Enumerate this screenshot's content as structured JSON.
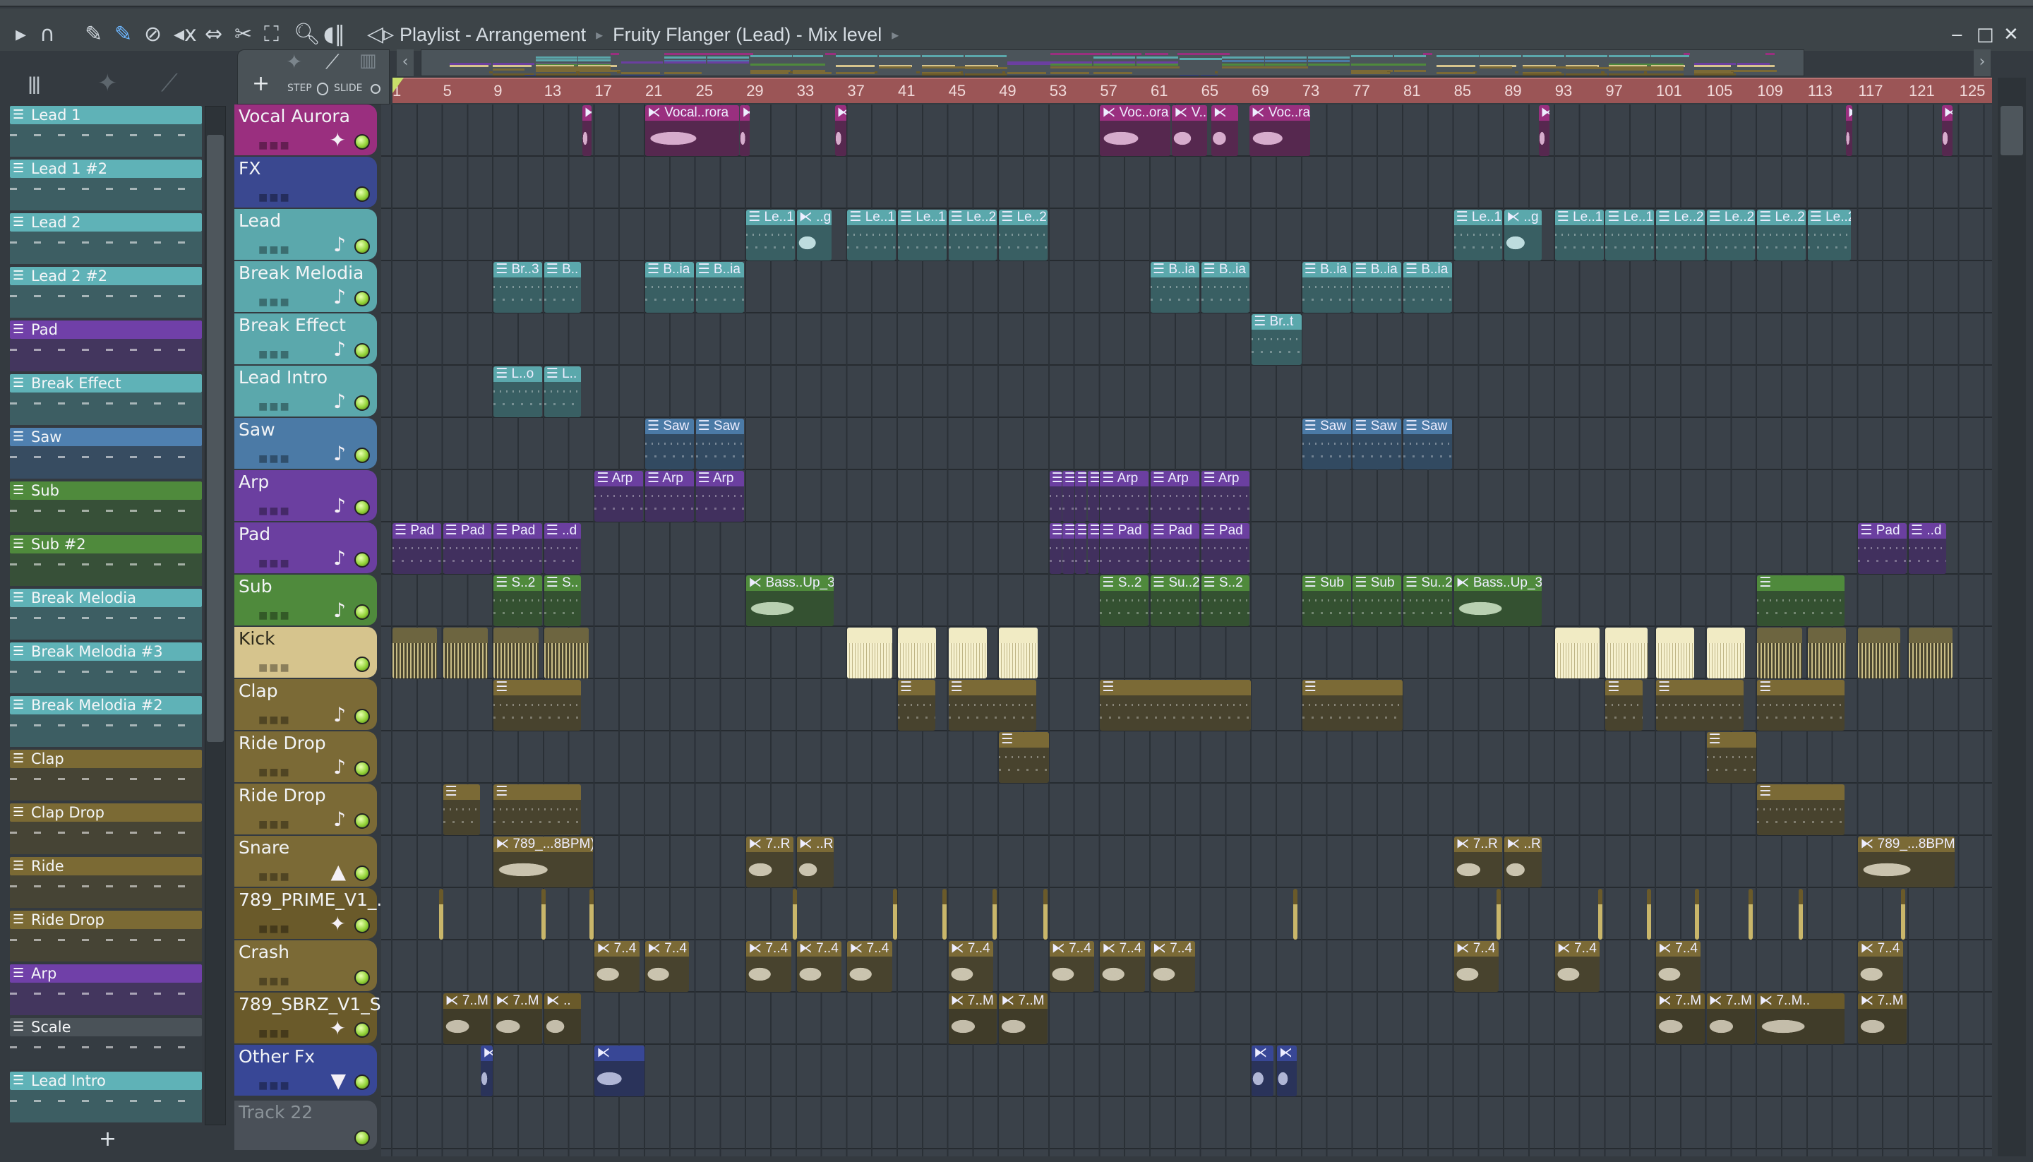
{
  "toolbar": {
    "breadcrumb_1": "Playlist - Arrangement",
    "breadcrumb_2": "Fruity Flanger (Lead) - Mix level",
    "step_label": "STEP",
    "slide_label": "SLIDE",
    "add_label": "+",
    "icons": [
      "arrow-icon",
      "magnet-icon",
      "pencil-icon",
      "paint-icon",
      "delete-icon",
      "mute-icon",
      "slip-icon",
      "slice-icon",
      "select-icon",
      "zoom-icon",
      "playback-icon",
      "speaker-icon"
    ]
  },
  "window": {
    "minimize": "‒",
    "maximize": "□",
    "close": "✕"
  },
  "ruler": {
    "labels": [
      "1",
      "5",
      "9",
      "13",
      "17",
      "21",
      "25",
      "29",
      "33",
      "37",
      "41",
      "45",
      "49",
      "53",
      "57",
      "61",
      "65",
      "69",
      "73",
      "77",
      "81",
      "85",
      "89",
      "93",
      "97",
      "101",
      "105",
      "109",
      "113",
      "117",
      "121",
      "125"
    ]
  },
  "channels": [
    {
      "name": "Lead 1",
      "color": "#5fb2b7"
    },
    {
      "name": "Lead 1 #2",
      "color": "#5fb2b7"
    },
    {
      "name": "Lead 2",
      "color": "#5fb2b7"
    },
    {
      "name": "Lead 2 #2",
      "color": "#5fb2b7"
    },
    {
      "name": "Pad",
      "color": "#7040a8"
    },
    {
      "name": "Break Effect",
      "color": "#5fb2b7"
    },
    {
      "name": "Saw",
      "color": "#4f80b0"
    },
    {
      "name": "Sub",
      "color": "#4f8a3c"
    },
    {
      "name": "Sub #2",
      "color": "#4f8a3c"
    },
    {
      "name": "Break Melodia",
      "color": "#5fb2b7"
    },
    {
      "name": "Break Melodia #3",
      "color": "#5fb2b7"
    },
    {
      "name": "Break Melodia #2",
      "color": "#5fb2b7"
    },
    {
      "name": "Clap",
      "color": "#7b6a34"
    },
    {
      "name": "Clap Drop",
      "color": "#7b6a34"
    },
    {
      "name": "Ride",
      "color": "#7b6a34"
    },
    {
      "name": "Ride Drop",
      "color": "#7b6a34"
    },
    {
      "name": "Arp",
      "color": "#7040a8"
    },
    {
      "name": "Scale",
      "color": "#4a5258"
    },
    {
      "name": "Lead Intro",
      "color": "#5fb2b7"
    }
  ],
  "channel_add": "+",
  "tracks": [
    {
      "name": "Vocal Aurora",
      "color": "#9a2f7f",
      "icon": "✦",
      "clips": [
        {
          "s": 16,
          "l": 0.8,
          "t": "",
          "k": "a"
        },
        {
          "s": 21,
          "l": 7.5,
          "t": "Vocal..rora",
          "k": "a"
        },
        {
          "s": 28.5,
          "l": 0.8,
          "t": "",
          "k": "a"
        },
        {
          "s": 36,
          "l": 1,
          "t": "",
          "k": "a"
        },
        {
          "s": 57,
          "l": 5.6,
          "t": "Voc..ora",
          "k": "a"
        },
        {
          "s": 62.7,
          "l": 2.8,
          "t": "V..",
          "k": "a"
        },
        {
          "s": 65.8,
          "l": 2.2,
          "t": "",
          "k": "a"
        },
        {
          "s": 68.8,
          "l": 4.9,
          "t": "Voc..ra",
          "k": "a"
        },
        {
          "s": 91.7,
          "l": 0.9,
          "t": "",
          "k": "a"
        },
        {
          "s": 116,
          "l": 0.6,
          "t": "",
          "k": "a"
        },
        {
          "s": 123.6,
          "l": 0.9,
          "t": "",
          "k": "a"
        }
      ]
    },
    {
      "name": "FX",
      "color": "#3a4890",
      "icon": "",
      "clips": []
    },
    {
      "name": "Lead",
      "color": "#5ba8ac",
      "icon": "♪",
      "clips": [
        {
          "s": 29,
          "l": 3.9,
          "t": "Le..1",
          "k": "p"
        },
        {
          "s": 33,
          "l": 2.8,
          "t": "..g",
          "k": "a"
        },
        {
          "s": 37,
          "l": 3.9,
          "t": "Le..1",
          "k": "p"
        },
        {
          "s": 41,
          "l": 3.9,
          "t": "Le..1",
          "k": "p"
        },
        {
          "s": 45,
          "l": 3.9,
          "t": "Le..2",
          "k": "p"
        },
        {
          "s": 49,
          "l": 3.9,
          "t": "Le..2",
          "k": "p"
        },
        {
          "s": 85,
          "l": 3.9,
          "t": "Le..1",
          "k": "p"
        },
        {
          "s": 89,
          "l": 3,
          "t": "..g",
          "k": "a"
        },
        {
          "s": 93,
          "l": 3.9,
          "t": "Le..1",
          "k": "p"
        },
        {
          "s": 97,
          "l": 3.9,
          "t": "Le..1",
          "k": "p"
        },
        {
          "s": 101,
          "l": 3.9,
          "t": "Le..2",
          "k": "p"
        },
        {
          "s": 105,
          "l": 3.9,
          "t": "Le..2",
          "k": "p"
        },
        {
          "s": 109,
          "l": 3.9,
          "t": "Le..2",
          "k": "p"
        },
        {
          "s": 113,
          "l": 3.5,
          "t": "Le..2",
          "k": "p"
        }
      ]
    },
    {
      "name": "Break Melodia",
      "color": "#5ba8ac",
      "icon": "♪",
      "clips": [
        {
          "s": 9,
          "l": 3.9,
          "t": "Br..3",
          "k": "p"
        },
        {
          "s": 13,
          "l": 3,
          "t": "B..",
          "k": "p"
        },
        {
          "s": 21,
          "l": 3.9,
          "t": "B..ia",
          "k": "p"
        },
        {
          "s": 25,
          "l": 3.9,
          "t": "B..ia",
          "k": "p"
        },
        {
          "s": 61,
          "l": 3.9,
          "t": "B..ia",
          "k": "p"
        },
        {
          "s": 65,
          "l": 3.9,
          "t": "B..ia",
          "k": "p"
        },
        {
          "s": 73,
          "l": 3.9,
          "t": "B..ia",
          "k": "p"
        },
        {
          "s": 77,
          "l": 3.9,
          "t": "B..ia",
          "k": "p"
        },
        {
          "s": 81,
          "l": 3.9,
          "t": "B..ia",
          "k": "p"
        }
      ]
    },
    {
      "name": "Break Effect",
      "color": "#5ba8ac",
      "icon": "♪",
      "clips": [
        {
          "s": 69,
          "l": 4,
          "t": "Br..t",
          "k": "p"
        }
      ]
    },
    {
      "name": "Lead Intro",
      "color": "#5ba8ac",
      "icon": "♪",
      "clips": [
        {
          "s": 9,
          "l": 3.9,
          "t": "L..o",
          "k": "p"
        },
        {
          "s": 13,
          "l": 3,
          "t": "L..",
          "k": "p"
        }
      ]
    },
    {
      "name": "Saw",
      "color": "#4b7aa6",
      "icon": "♪",
      "clips": [
        {
          "s": 21,
          "l": 3.9,
          "t": "Saw",
          "k": "p"
        },
        {
          "s": 25,
          "l": 3.9,
          "t": "Saw",
          "k": "p"
        },
        {
          "s": 73,
          "l": 3.9,
          "t": "Saw",
          "k": "p"
        },
        {
          "s": 77,
          "l": 3.9,
          "t": "Saw",
          "k": "p"
        },
        {
          "s": 81,
          "l": 3.9,
          "t": "Saw",
          "k": "p"
        }
      ]
    },
    {
      "name": "Arp",
      "color": "#6b3fa0",
      "icon": "♪",
      "clips": [
        {
          "s": 17,
          "l": 3.9,
          "t": "Arp",
          "k": "p"
        },
        {
          "s": 21,
          "l": 3.9,
          "t": "Arp",
          "k": "p"
        },
        {
          "s": 25,
          "l": 3.9,
          "t": "Arp",
          "k": "p"
        },
        {
          "s": 53,
          "l": 1,
          "t": "",
          "k": "p"
        },
        {
          "s": 54,
          "l": 1,
          "t": "",
          "k": "p"
        },
        {
          "s": 55,
          "l": 1,
          "t": "",
          "k": "p"
        },
        {
          "s": 56,
          "l": 1,
          "t": "",
          "k": "p"
        },
        {
          "s": 57,
          "l": 3.9,
          "t": "Arp",
          "k": "p"
        },
        {
          "s": 61,
          "l": 3.9,
          "t": "Arp",
          "k": "p"
        },
        {
          "s": 65,
          "l": 3.9,
          "t": "Arp",
          "k": "p"
        }
      ]
    },
    {
      "name": "Pad",
      "color": "#6b3fa0",
      "icon": "♪",
      "clips": [
        {
          "s": 1,
          "l": 3.9,
          "t": "Pad",
          "k": "p"
        },
        {
          "s": 5,
          "l": 3.9,
          "t": "Pad",
          "k": "p"
        },
        {
          "s": 9,
          "l": 3.9,
          "t": "Pad",
          "k": "p"
        },
        {
          "s": 13,
          "l": 3,
          "t": "..d",
          "k": "p"
        },
        {
          "s": 53,
          "l": 1,
          "t": "",
          "k": "p"
        },
        {
          "s": 54,
          "l": 1,
          "t": "",
          "k": "p"
        },
        {
          "s": 55,
          "l": 1,
          "t": "",
          "k": "p"
        },
        {
          "s": 56,
          "l": 1,
          "t": "",
          "k": "p"
        },
        {
          "s": 57,
          "l": 3.9,
          "t": "Pad",
          "k": "p"
        },
        {
          "s": 61,
          "l": 3.9,
          "t": "Pad",
          "k": "p"
        },
        {
          "s": 65,
          "l": 3.9,
          "t": "Pad",
          "k": "p"
        },
        {
          "s": 117,
          "l": 3.9,
          "t": "Pad",
          "k": "p"
        },
        {
          "s": 121,
          "l": 3,
          "t": "..d",
          "k": "p"
        }
      ]
    },
    {
      "name": "Sub",
      "color": "#4f8a3c",
      "icon": "♪",
      "clips": [
        {
          "s": 9,
          "l": 3.9,
          "t": "S..2",
          "k": "p"
        },
        {
          "s": 13,
          "l": 3,
          "t": "S..",
          "k": "p"
        },
        {
          "s": 29,
          "l": 7,
          "t": "Bass..Up_3",
          "k": "a"
        },
        {
          "s": 57,
          "l": 3.9,
          "t": "S..2",
          "k": "p"
        },
        {
          "s": 61,
          "l": 3.9,
          "t": "Su..2",
          "k": "p"
        },
        {
          "s": 65,
          "l": 3.9,
          "t": "S..2",
          "k": "p"
        },
        {
          "s": 73,
          "l": 3.9,
          "t": "Sub",
          "k": "p"
        },
        {
          "s": 77,
          "l": 3.9,
          "t": "Sub",
          "k": "p"
        },
        {
          "s": 81,
          "l": 3.9,
          "t": "Su..2",
          "k": "p"
        },
        {
          "s": 85,
          "l": 7,
          "t": "Bass..Up_3",
          "k": "a"
        },
        {
          "s": 109,
          "l": 7,
          "t": "",
          "k": "p"
        }
      ]
    },
    {
      "name": "Kick",
      "color": "#d6c48d",
      "icon": "",
      "clips": [
        {
          "s": 1,
          "l": 3.6,
          "t": "",
          "k": "k"
        },
        {
          "s": 5,
          "l": 3.6,
          "t": "",
          "k": "k"
        },
        {
          "s": 9,
          "l": 3.6,
          "t": "",
          "k": "k"
        },
        {
          "s": 13,
          "l": 3.6,
          "t": "",
          "k": "k"
        },
        {
          "s": 37,
          "l": 3.6,
          "t": "",
          "k": "h"
        },
        {
          "s": 41,
          "l": 3.1,
          "t": "",
          "k": "h"
        },
        {
          "s": 45,
          "l": 3.1,
          "t": "",
          "k": "h"
        },
        {
          "s": 49,
          "l": 3.1,
          "t": "",
          "k": "h"
        },
        {
          "s": 93,
          "l": 3.6,
          "t": "",
          "k": "h"
        },
        {
          "s": 97,
          "l": 3.4,
          "t": "",
          "k": "h"
        },
        {
          "s": 101,
          "l": 3.1,
          "t": "",
          "k": "h"
        },
        {
          "s": 105,
          "l": 3.1,
          "t": "",
          "k": "h"
        },
        {
          "s": 109,
          "l": 3.6,
          "t": "",
          "k": "k"
        },
        {
          "s": 113,
          "l": 3.1,
          "t": "",
          "k": "k"
        },
        {
          "s": 117,
          "l": 3.4,
          "t": "",
          "k": "k"
        },
        {
          "s": 121,
          "l": 3.5,
          "t": "",
          "k": "k"
        }
      ]
    },
    {
      "name": "Clap",
      "color": "#7b6a36",
      "icon": "♪",
      "clips": [
        {
          "s": 9,
          "l": 7,
          "t": "",
          "k": "p"
        },
        {
          "s": 41,
          "l": 3,
          "t": "",
          "k": "p"
        },
        {
          "s": 45,
          "l": 7,
          "t": "",
          "k": "p"
        },
        {
          "s": 57,
          "l": 12,
          "t": "",
          "k": "p"
        },
        {
          "s": 73,
          "l": 8,
          "t": "",
          "k": "p"
        },
        {
          "s": 97,
          "l": 3,
          "t": "",
          "k": "p"
        },
        {
          "s": 101,
          "l": 7,
          "t": "",
          "k": "p"
        },
        {
          "s": 109,
          "l": 7,
          "t": "",
          "k": "p"
        }
      ]
    },
    {
      "name": "Ride Drop",
      "color": "#7b6a36",
      "icon": "♪",
      "clips": [
        {
          "s": 49,
          "l": 4,
          "t": "",
          "k": "p"
        },
        {
          "s": 105,
          "l": 4,
          "t": "",
          "k": "p"
        }
      ]
    },
    {
      "name": "Ride Drop",
      "color": "#7b6a36",
      "icon": "♪",
      "clips": [
        {
          "s": 5,
          "l": 3,
          "t": "",
          "k": "p"
        },
        {
          "s": 9,
          "l": 7,
          "t": "",
          "k": "p"
        },
        {
          "s": 109,
          "l": 7,
          "t": "",
          "k": "p"
        }
      ]
    },
    {
      "name": "Snare",
      "color": "#7b6a36",
      "icon": "▲",
      "clips": [
        {
          "s": 9,
          "l": 7.9,
          "t": "789_...8BPM)",
          "k": "a"
        },
        {
          "s": 29,
          "l": 3.8,
          "t": "7..R",
          "k": "a"
        },
        {
          "s": 33,
          "l": 3,
          "t": "..R",
          "k": "a"
        },
        {
          "s": 85,
          "l": 3.9,
          "t": "7..R",
          "k": "a"
        },
        {
          "s": 89,
          "l": 3,
          "t": "..R",
          "k": "a"
        },
        {
          "s": 117,
          "l": 7.7,
          "t": "789_...8BPM)",
          "k": "a"
        }
      ]
    },
    {
      "name": "789_PRIME_V1_...",
      "color": "#6a5a2a",
      "icon": "✦",
      "clips": [
        {
          "s": 4.7,
          "l": 0.3,
          "t": "",
          "k": "s"
        },
        {
          "s": 12.8,
          "l": 0.3,
          "t": "",
          "k": "s"
        },
        {
          "s": 16.6,
          "l": 0.3,
          "t": "",
          "k": "s"
        },
        {
          "s": 32.7,
          "l": 0.3,
          "t": "",
          "k": "s"
        },
        {
          "s": 40.6,
          "l": 0.3,
          "t": "",
          "k": "s"
        },
        {
          "s": 44.5,
          "l": 0.3,
          "t": "",
          "k": "s"
        },
        {
          "s": 48.5,
          "l": 0.3,
          "t": "",
          "k": "s"
        },
        {
          "s": 52.5,
          "l": 0.3,
          "t": "",
          "k": "s"
        },
        {
          "s": 72.3,
          "l": 0.3,
          "t": "",
          "k": "s"
        },
        {
          "s": 88.4,
          "l": 0.3,
          "t": "",
          "k": "s"
        },
        {
          "s": 96.4,
          "l": 0.3,
          "t": "",
          "k": "s"
        },
        {
          "s": 100.3,
          "l": 0.3,
          "t": "",
          "k": "s"
        },
        {
          "s": 104.1,
          "l": 0.3,
          "t": "",
          "k": "s"
        },
        {
          "s": 108.3,
          "l": 0.3,
          "t": "",
          "k": "s"
        },
        {
          "s": 112.3,
          "l": 0.3,
          "t": "",
          "k": "s"
        },
        {
          "s": 120.4,
          "l": 0.3,
          "t": "",
          "k": "s"
        }
      ]
    },
    {
      "name": "Crash",
      "color": "#7b6a36",
      "icon": "",
      "clips": [
        {
          "s": 17,
          "l": 3.6,
          "t": "7..4",
          "k": "a"
        },
        {
          "s": 21,
          "l": 3.5,
          "t": "7..4",
          "k": "a"
        },
        {
          "s": 29,
          "l": 3.6,
          "t": "7..4",
          "k": "a"
        },
        {
          "s": 33,
          "l": 3.6,
          "t": "7..4",
          "k": "a"
        },
        {
          "s": 37,
          "l": 3.6,
          "t": "7..4",
          "k": "a"
        },
        {
          "s": 45,
          "l": 3.6,
          "t": "7..4",
          "k": "a"
        },
        {
          "s": 53,
          "l": 3.6,
          "t": "7..4",
          "k": "a"
        },
        {
          "s": 57,
          "l": 3.6,
          "t": "7..4",
          "k": "a"
        },
        {
          "s": 61,
          "l": 3.6,
          "t": "7..4",
          "k": "a"
        },
        {
          "s": 85,
          "l": 3.6,
          "t": "7..4",
          "k": "a"
        },
        {
          "s": 93,
          "l": 3.6,
          "t": "7..4",
          "k": "a"
        },
        {
          "s": 101,
          "l": 3.6,
          "t": "7..4",
          "k": "a"
        },
        {
          "s": 117,
          "l": 3.6,
          "t": "7..4",
          "k": "a"
        }
      ]
    },
    {
      "name": "789_SBRZ_V1_SA...",
      "color": "#6a5a2a",
      "icon": "✦",
      "clips": [
        {
          "s": 5,
          "l": 3.8,
          "t": "7..M",
          "k": "a"
        },
        {
          "s": 9,
          "l": 3.9,
          "t": "7..M",
          "k": "a"
        },
        {
          "s": 13,
          "l": 3,
          "t": "..",
          "k": "a"
        },
        {
          "s": 45,
          "l": 3.9,
          "t": "7..M",
          "k": "a"
        },
        {
          "s": 49,
          "l": 3.9,
          "t": "7..M",
          "k": "a"
        },
        {
          "s": 101,
          "l": 3.9,
          "t": "7..M",
          "k": "a"
        },
        {
          "s": 105,
          "l": 3.9,
          "t": "7..M",
          "k": "a"
        },
        {
          "s": 109,
          "l": 7,
          "t": "7..M..",
          "k": "a"
        },
        {
          "s": 117,
          "l": 3.9,
          "t": "7..M",
          "k": "a"
        }
      ]
    },
    {
      "name": "Other Fx",
      "color": "#384796",
      "icon": "▼",
      "clips": [
        {
          "s": 8,
          "l": 1,
          "t": "",
          "k": "a"
        },
        {
          "s": 17,
          "l": 4,
          "t": "",
          "k": "a"
        },
        {
          "s": 69,
          "l": 1.8,
          "t": "",
          "k": "a"
        },
        {
          "s": 71,
          "l": 1.6,
          "t": "",
          "k": "a"
        }
      ]
    }
  ],
  "track22": {
    "name": "Track 22",
    "color": "#4a5058"
  }
}
